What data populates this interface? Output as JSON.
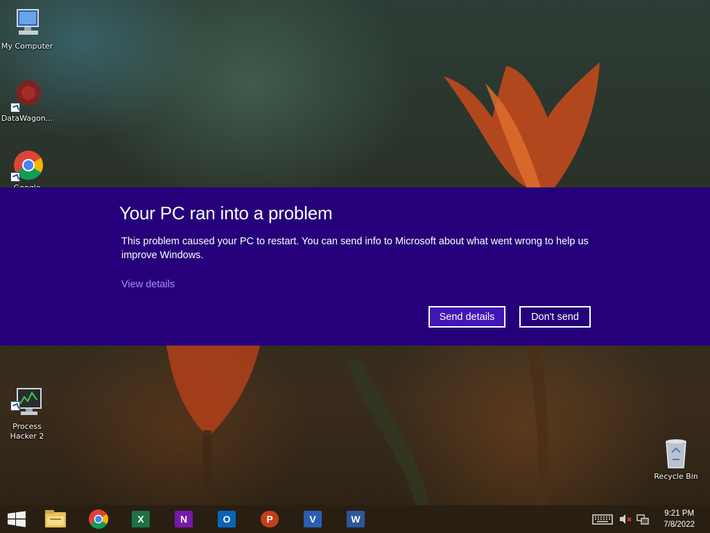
{
  "desktop": {
    "icons": [
      {
        "label": "My Computer"
      },
      {
        "label": "DataWagon..."
      },
      {
        "label": "Google Chrome"
      },
      {
        "label": "Process\nHacker 2"
      },
      {
        "label": "Recycle Bin"
      }
    ]
  },
  "dialog": {
    "title": "Your PC ran into a problem",
    "body": "This problem caused your PC to restart. You can send info to Microsoft about what went wrong to help us improve Windows.",
    "view_details": "View details",
    "send_button": "Send details",
    "dont_send_button": "Don't send",
    "colors": {
      "background": "#25007a",
      "link": "#a98bff",
      "primary_button": "#4016b6"
    }
  },
  "taskbar": {
    "start_icon": "windows-logo-icon",
    "pinned": [
      {
        "name": "file-explorer-icon"
      },
      {
        "name": "chrome-icon"
      },
      {
        "name": "excel-icon",
        "letter": "X",
        "color": "#1e7145"
      },
      {
        "name": "onenote-icon",
        "letter": "N",
        "color": "#7719aa"
      },
      {
        "name": "outlook-icon",
        "letter": "O",
        "color": "#0a64b8"
      },
      {
        "name": "powerpoint-icon",
        "letter": "P",
        "color": "#c43e1c"
      },
      {
        "name": "visio-icon",
        "letter": "V",
        "color": "#2b5fb3"
      },
      {
        "name": "word-icon",
        "letter": "W",
        "color": "#2b579a"
      }
    ],
    "tray": {
      "icons": [
        "keyboard-icon",
        "volume-muted-icon",
        "network-icon"
      ],
      "time": "9:21 PM",
      "date": "7/8/2022"
    }
  }
}
